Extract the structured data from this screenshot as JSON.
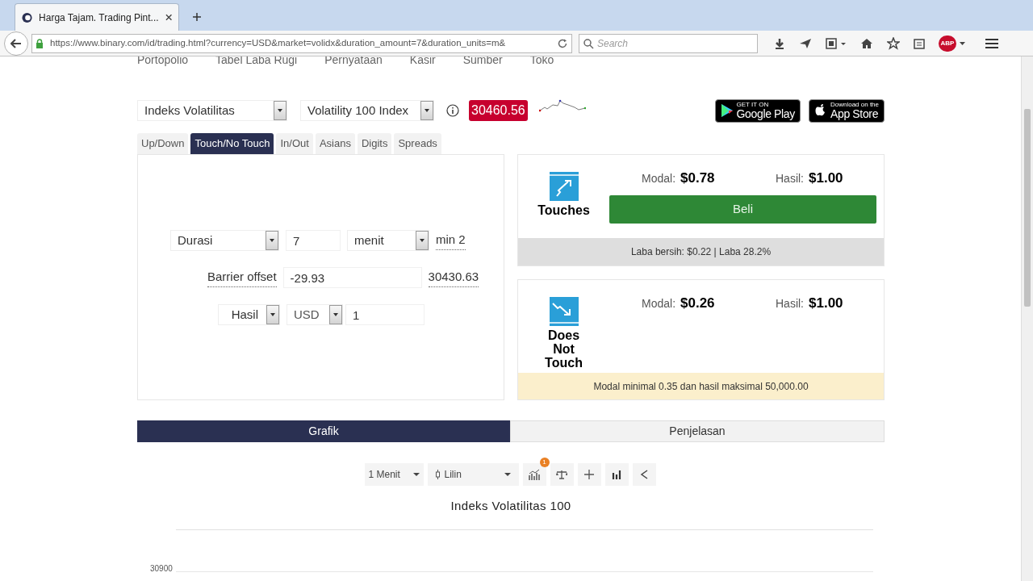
{
  "browser": {
    "tab_title": "Harga Tajam. Trading Pint...",
    "url": "https://www.binary.com/id/trading.html?currency=USD&market=volidx&duration_amount=7&duration_units=m&",
    "search_placeholder": "Search",
    "adblock_label": "ABP"
  },
  "nav_menu": [
    "Portopolio",
    "Tabel Laba Rugi",
    "Pernyataan",
    "Kasir",
    "Sumber",
    "Toko"
  ],
  "market_select": "Indeks Volatilitas",
  "underlying_select": "Volatility 100 Index",
  "spot_price": "30460.56",
  "store_badges": [
    {
      "kind": "google",
      "small": "GET IT ON",
      "big": "Google Play"
    },
    {
      "kind": "apple",
      "small": "Download on the",
      "big": "App Store"
    }
  ],
  "contract_tabs": [
    {
      "label": "Up/Down",
      "selected": false
    },
    {
      "label": "Touch/No Touch",
      "selected": true
    },
    {
      "label": "In/Out",
      "selected": false
    },
    {
      "label": "Asians",
      "selected": false
    },
    {
      "label": "Digits",
      "selected": false
    },
    {
      "label": "Spreads",
      "selected": false
    }
  ],
  "form": {
    "duration": {
      "select": "Durasi",
      "amount": "7",
      "unit": "menit",
      "minimum": "min 2"
    },
    "barrier": {
      "label": "Barrier offset",
      "value": "-29.93",
      "absolute": "30430.63"
    },
    "payout": {
      "basis": "Hasil",
      "currency": "USD",
      "amount": "1"
    }
  },
  "contracts": [
    {
      "kind": "touch",
      "name": "Touches",
      "stake_label": "Modal:",
      "stake": "$0.78",
      "payout_label": "Hasil:",
      "payout": "$1.00",
      "buy_button": "Beli",
      "footer": "Laba bersih: $0.22 | Laba 28.2%"
    },
    {
      "kind": "no_touch",
      "name": "Does Not Touch",
      "stake_label": "Modal:",
      "stake": "$0.26",
      "payout_label": "Hasil:",
      "payout": "$1.00",
      "footer": "Modal minimal 0.35 dan hasil maksimal 50,000.00"
    }
  ],
  "bottom_tabs": [
    {
      "label": "Grafik",
      "selected": true
    },
    {
      "label": "Penjelasan",
      "selected": false
    }
  ],
  "chart_toolbar": {
    "interval": "1 Menit",
    "chart_type": "Lilin",
    "indicator_count": "1"
  },
  "chart": {
    "title": "Indeks Volatilitas 100",
    "y_tick": "30900"
  }
}
